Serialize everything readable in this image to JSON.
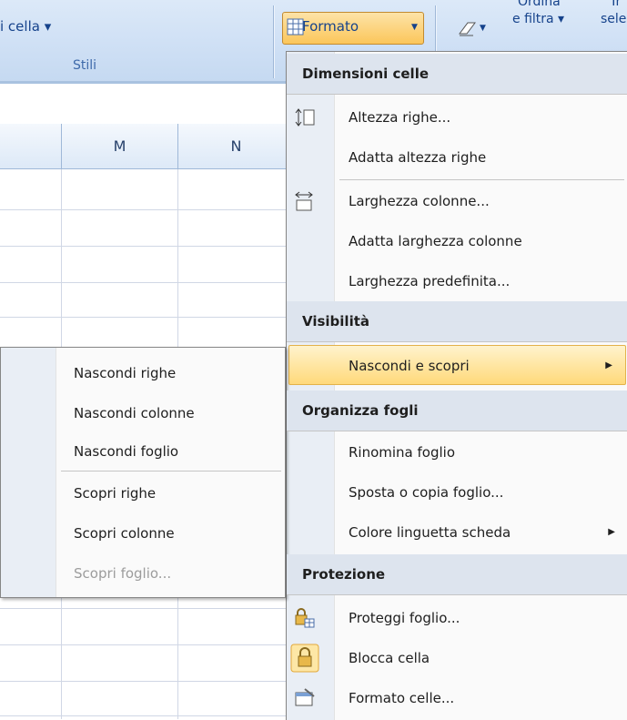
{
  "ribbon": {
    "cell_styles_label": "i cella ▾",
    "styles_group": "Stili",
    "formato_button": "Formato",
    "ordina_line1": "Ordina",
    "ordina_line2": "e filtra ▾",
    "trova_line1": "Tr",
    "trova_line2": "sele"
  },
  "grid": {
    "columns": [
      "M",
      "N"
    ]
  },
  "format_menu": {
    "section1": "Dimensioni celle",
    "altezza_righe": "Altezza righe...",
    "adatta_altezza": "Adatta altezza righe",
    "larghezza_colonne": "Larghezza colonne...",
    "adatta_larghezza": "Adatta larghezza colonne",
    "larghezza_predefinita": "Larghezza predefinita...",
    "section2": "Visibilità",
    "nascondi_scopri": "Nascondi e scopri",
    "section3": "Organizza fogli",
    "rinomina": "Rinomina foglio",
    "sposta": "Sposta o copia foglio...",
    "colore": "Colore linguetta scheda",
    "section4": "Protezione",
    "proteggi": "Proteggi foglio...",
    "blocca": "Blocca cella",
    "formato_celle": "Formato celle..."
  },
  "hide_submenu": {
    "nascondi_righe": "Nascondi righe",
    "nascondi_colonne": "Nascondi colonne",
    "nascondi_foglio": "Nascondi foglio",
    "scopri_righe": "Scopri righe",
    "scopri_colonne": "Scopri colonne",
    "scopri_foglio": "Scopri foglio..."
  },
  "colors": {
    "highlight": "#ffd97a",
    "ribbon": "#cfe0f5",
    "section_header": "#dde4ee"
  }
}
